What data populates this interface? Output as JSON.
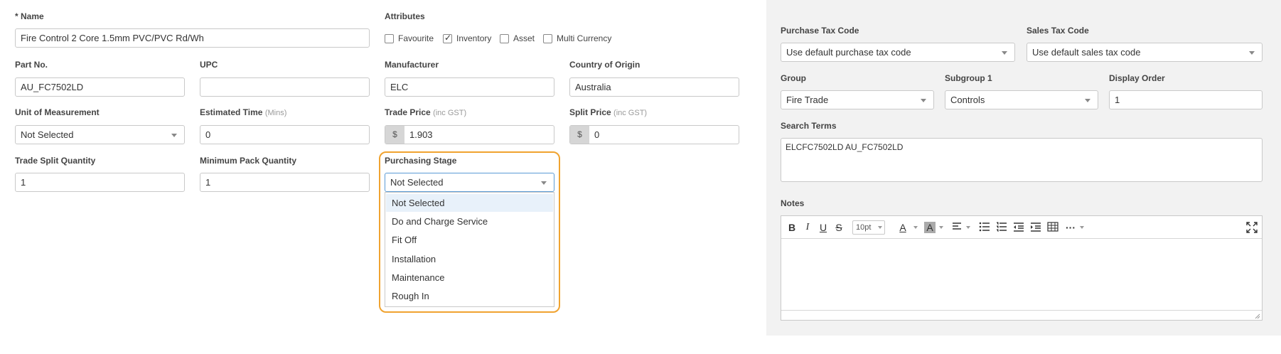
{
  "form": {
    "name": {
      "label": "* Name",
      "value": "Fire Control 2 Core 1.5mm PVC/PVC Rd/Wh"
    },
    "attributes": {
      "label": "Attributes",
      "options": [
        {
          "label": "Favourite",
          "checked": false
        },
        {
          "label": "Inventory",
          "checked": true
        },
        {
          "label": "Asset",
          "checked": false
        },
        {
          "label": "Multi Currency",
          "checked": false
        }
      ]
    },
    "part_no": {
      "label": "Part No.",
      "value": "AU_FC7502LD"
    },
    "upc": {
      "label": "UPC",
      "value": ""
    },
    "manufacturer": {
      "label": "Manufacturer",
      "value": "ELC"
    },
    "country": {
      "label": "Country of Origin",
      "value": "Australia"
    },
    "uom": {
      "label": "Unit of Measurement",
      "value": "Not Selected"
    },
    "est_time": {
      "label": "Estimated Time",
      "sub": "(Mins)",
      "value": "0"
    },
    "trade_price": {
      "label": "Trade Price",
      "sub": "(inc GST)",
      "prefix": "$",
      "value": "1.903"
    },
    "split_price": {
      "label": "Split Price",
      "sub": "(inc GST)",
      "prefix": "$",
      "value": "0"
    },
    "trade_split_qty": {
      "label": "Trade Split Quantity",
      "value": "1"
    },
    "min_pack_qty": {
      "label": "Minimum Pack Quantity",
      "value": "1"
    },
    "purchasing_stage": {
      "label": "Purchasing Stage",
      "value": "Not Selected",
      "options": [
        "Not Selected",
        "Do and Charge Service",
        "Fit Off",
        "Installation",
        "Maintenance",
        "Rough In"
      ],
      "highlight_color": "#f0a330"
    }
  },
  "panel": {
    "purchase_tax": {
      "label": "Purchase Tax Code",
      "value": "Use default purchase tax code"
    },
    "sales_tax": {
      "label": "Sales Tax Code",
      "value": "Use default sales tax code"
    },
    "group": {
      "label": "Group",
      "value": "Fire Trade"
    },
    "subgroup": {
      "label": "Subgroup 1",
      "value": "Controls"
    },
    "display_order": {
      "label": "Display Order",
      "value": "1"
    },
    "search_terms": {
      "label": "Search Terms",
      "value": "ELCFC7502LD AU_FC7502LD"
    },
    "notes": {
      "label": "Notes",
      "toolbar": {
        "bold": "B",
        "italic": "I",
        "underline": "U",
        "strike": "S",
        "font_size": "10pt",
        "font_color": "A",
        "bg_color": "A",
        "align_icon": "align-left-icon",
        "bullet_icon": "bullet-list-icon",
        "number_icon": "numbered-list-icon",
        "outdent_icon": "outdent-icon",
        "indent_icon": "indent-icon",
        "table_icon": "table-icon",
        "more": "···",
        "fullscreen_icon": "fullscreen-icon"
      }
    }
  }
}
